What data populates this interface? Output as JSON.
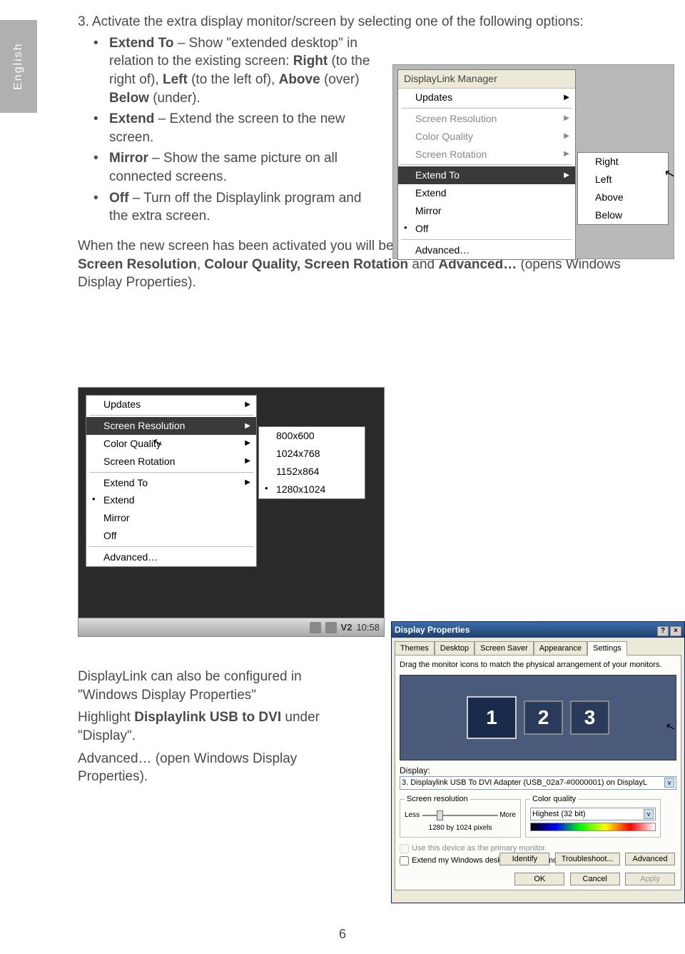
{
  "language_tab": "English",
  "page_number": "6",
  "step": {
    "num": "3.",
    "intro": "Activate the extra display monitor/screen by selecting one of the following options:"
  },
  "bullets": {
    "b1a": "Extend To",
    "b1b": " – Show \"extended desktop\" in relation to the existing screen: ",
    "b1c": "Right",
    "b1d": " (to the right of), ",
    "b1e": "Left",
    "b1f": " (to the left of), ",
    "b1g": "Above",
    "b1h": " (over) ",
    "b1i": "Below",
    "b1j": " (under).",
    "b2a": "Extend",
    "b2b": " – Extend the screen to the new screen.",
    "b3a": "Mirror",
    "b3b": " – Show the same picture on all connected screens.",
    "b4a": "Off",
    "b4b": " – Turn off the Displaylink program and the extra screen."
  },
  "para1a": "When the new screen has been activated you will be able to adjust the following settings: ",
  "para1b": "Screen Resolution",
  "para1c": ", ",
  "para1d": "Colour Quality, Screen Rotation",
  "para1e": " and ",
  "para1f": "Advanced…",
  "para1g": " (opens Windows Display Properties).",
  "lower": {
    "l1": "DisplayLink can also be configured in \"Windows Display Properties\"",
    "l2a": "Highlight ",
    "l2b": "Displaylink USB to DVI",
    "l2c": " under \"Display\".",
    "l3": "Advanced… (open Windows Display Properties)."
  },
  "menu1": {
    "title": "DisplayLink Manager",
    "updates": "Updates",
    "sr": "Screen Resolution",
    "cq": "Color Quality",
    "srot": "Screen Rotation",
    "ext_to": "Extend To",
    "ext": "Extend",
    "mirror": "Mirror",
    "off": "Off",
    "adv": "Advanced…",
    "right": "Right",
    "left": "Left",
    "above": "Above",
    "below": "Below"
  },
  "menu2": {
    "updates": "Updates",
    "sr": "Screen Resolution",
    "cq": "Color Quality",
    "srot": "Screen Rotation",
    "ext_to": "Extend To",
    "ext": "Extend",
    "mirror": "Mirror",
    "off": "Off",
    "adv": "Advanced…",
    "r1": "800x600",
    "r2": "1024x768",
    "r3": "1152x864",
    "r4": "1280x1024",
    "time": "10:58"
  },
  "dp": {
    "title": "Display Properties",
    "tabs": {
      "themes": "Themes",
      "desktop": "Desktop",
      "ss": "Screen Saver",
      "app": "Appearance",
      "settings": "Settings"
    },
    "dragtext": "Drag the monitor icons to match the physical arrangement of your monitors.",
    "m1": "1",
    "m2": "2",
    "m3": "3",
    "display_label": "Display:",
    "display_value": "3. Displaylink USB To DVI Adapter (USB_02a7-#0000001) on DisplayL",
    "sr_legend": "Screen resolution",
    "less": "Less",
    "more": "More",
    "pixels": "1280 by 1024 pixels",
    "cq_legend": "Color quality",
    "cq_value": "Highest (32 bit)",
    "chk1": "Use this device as the primary monitor.",
    "chk2": "Extend my Windows desktop onto this monitor.",
    "identify": "Identify",
    "trouble": "Troubleshoot...",
    "advanced": "Advanced",
    "ok": "OK",
    "cancel": "Cancel",
    "apply": "Apply"
  }
}
